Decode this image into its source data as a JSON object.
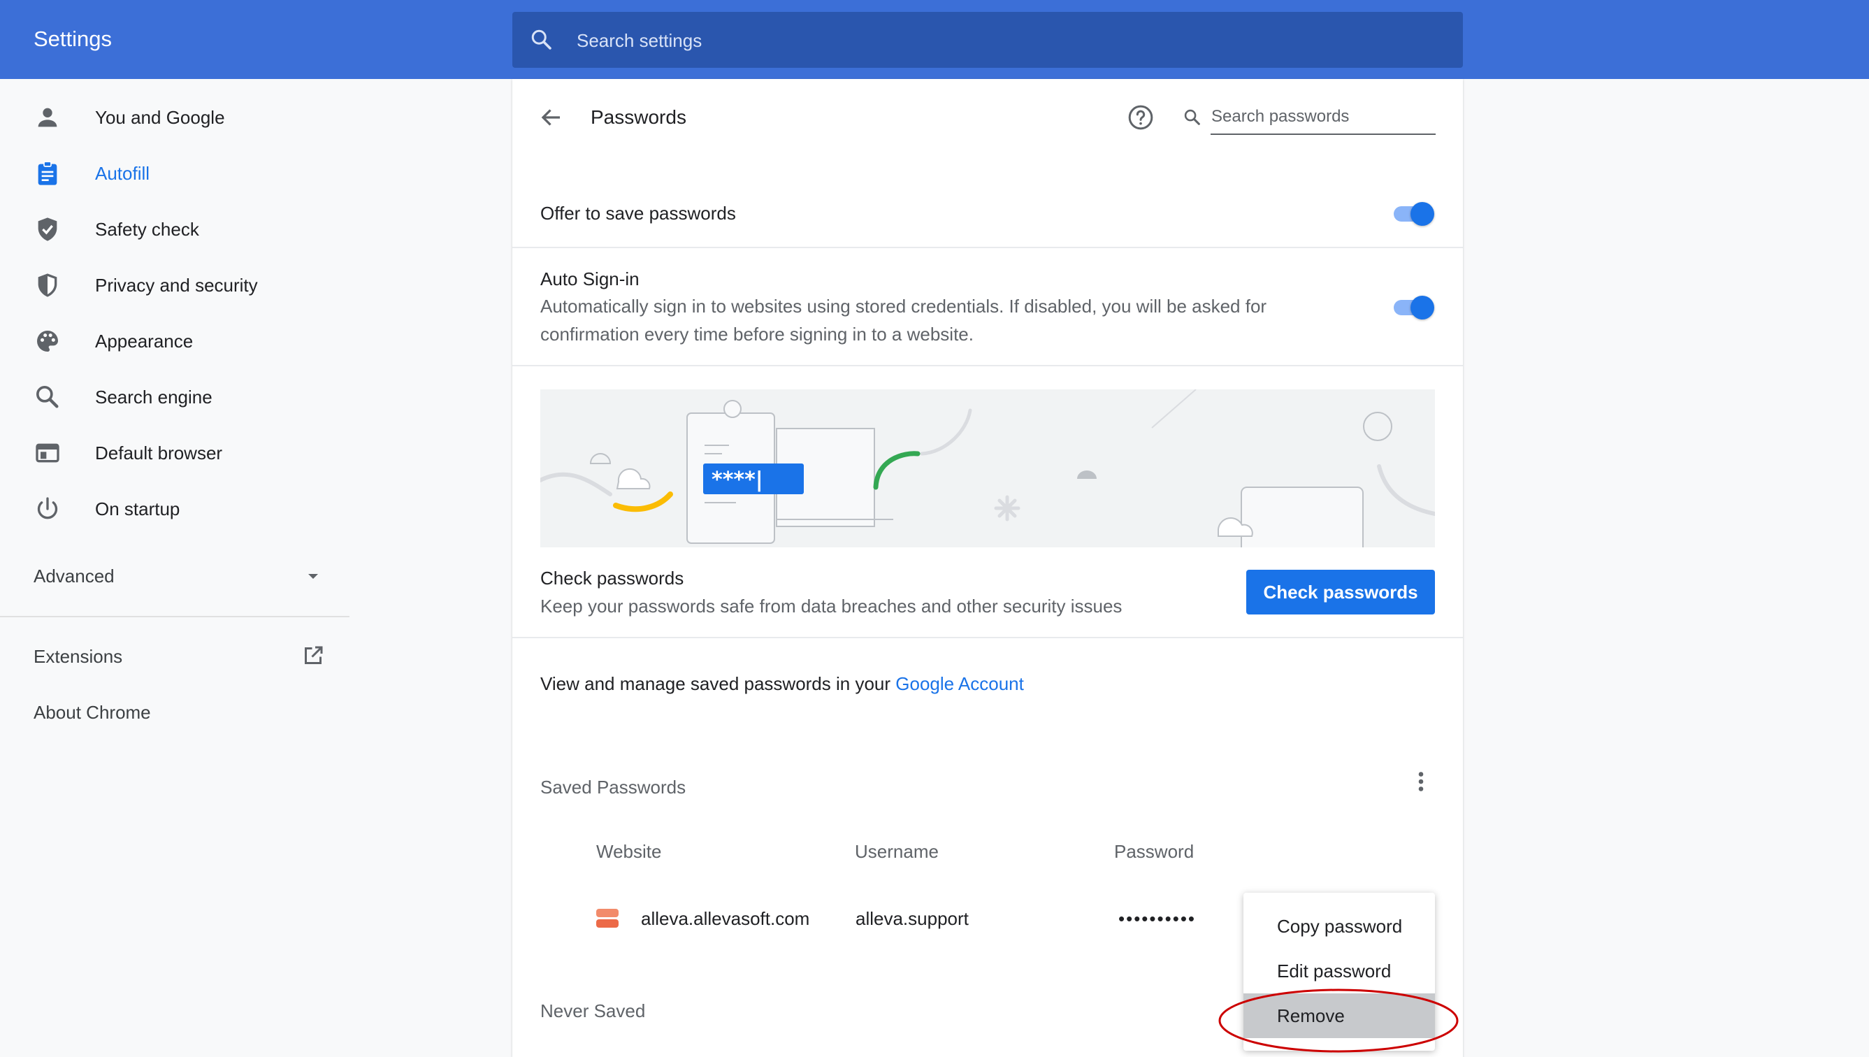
{
  "header": {
    "title": "Settings",
    "search_placeholder": "Search settings"
  },
  "sidebar": {
    "items": [
      {
        "label": "You and Google",
        "icon": "person-icon"
      },
      {
        "label": "Autofill",
        "icon": "clipboard-icon",
        "active": true
      },
      {
        "label": "Safety check",
        "icon": "shield-check-icon"
      },
      {
        "label": "Privacy and security",
        "icon": "shield-half-icon"
      },
      {
        "label": "Appearance",
        "icon": "palette-icon"
      },
      {
        "label": "Search engine",
        "icon": "search-icon"
      },
      {
        "label": "Default browser",
        "icon": "browser-window-icon"
      },
      {
        "label": "On startup",
        "icon": "power-icon"
      }
    ],
    "advanced": "Advanced",
    "extensions": "Extensions",
    "about": "About Chrome"
  },
  "passwords_page": {
    "title": "Passwords",
    "search_placeholder": "Search passwords",
    "offer_to_save": {
      "label": "Offer to save passwords",
      "enabled": true
    },
    "auto_signin": {
      "label": "Auto Sign-in",
      "desc_line1": "Automatically sign in to websites using stored credentials. If disabled, you will be asked for",
      "desc_line2": "confirmation every time before signing in to a website.",
      "enabled": true
    },
    "illustration_text": "****|",
    "check": {
      "title": "Check passwords",
      "desc": "Keep your passwords safe from data breaches and other security issues",
      "button": "Check passwords"
    },
    "manage": {
      "text": "View and manage saved passwords in your",
      "link": "Google Account"
    },
    "saved": {
      "heading": "Saved Passwords",
      "columns": [
        "Website",
        "Username",
        "Password"
      ],
      "rows": [
        {
          "website": "alleva.allevasoft.com",
          "username": "alleva.support",
          "password": "••••••••••"
        }
      ]
    },
    "never_saved": "Never Saved"
  },
  "context_menu": {
    "items": [
      "Copy password",
      "Edit password",
      "Remove"
    ],
    "highlighted": "Remove"
  },
  "colors": {
    "header": "#3c6fd7",
    "search_bar": "#2a56ae",
    "accent": "#1a73e8",
    "annotation": "#cc0000"
  }
}
